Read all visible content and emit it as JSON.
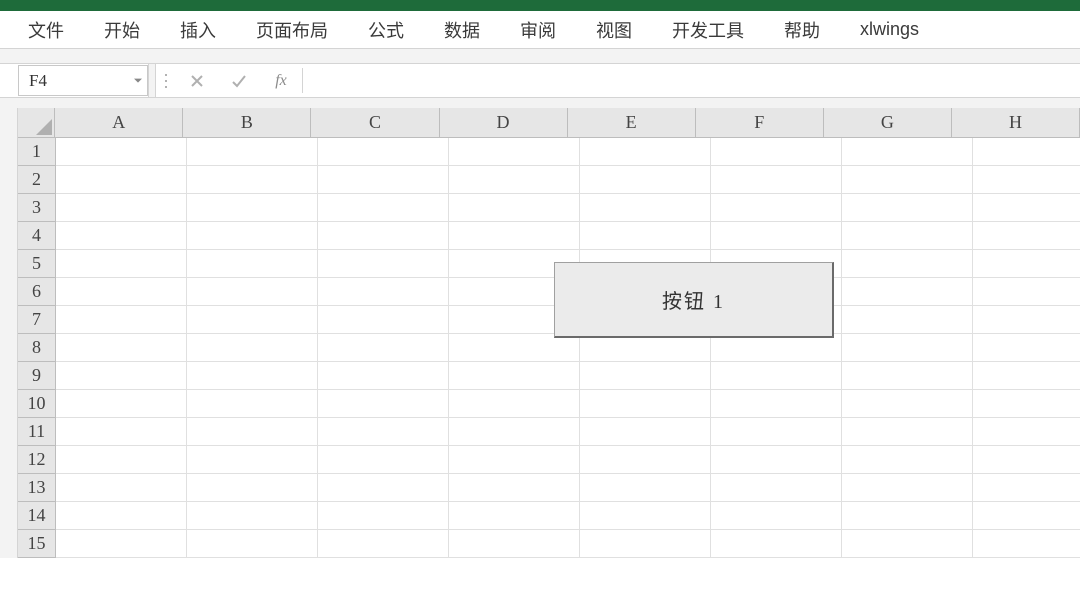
{
  "ribbon": {
    "tabs": [
      "文件",
      "开始",
      "插入",
      "页面布局",
      "公式",
      "数据",
      "审阅",
      "视图",
      "开发工具",
      "帮助",
      "xlwings"
    ]
  },
  "formula_bar": {
    "name_box": "F4",
    "fx_label": "fx",
    "formula": ""
  },
  "grid": {
    "columns": [
      "A",
      "B",
      "C",
      "D",
      "E",
      "F",
      "G",
      "H"
    ],
    "rows": [
      "1",
      "2",
      "3",
      "4",
      "5",
      "6",
      "7",
      "8",
      "9",
      "10",
      "11",
      "12",
      "13",
      "14",
      "15"
    ]
  },
  "button": {
    "label": "按钮 1"
  }
}
